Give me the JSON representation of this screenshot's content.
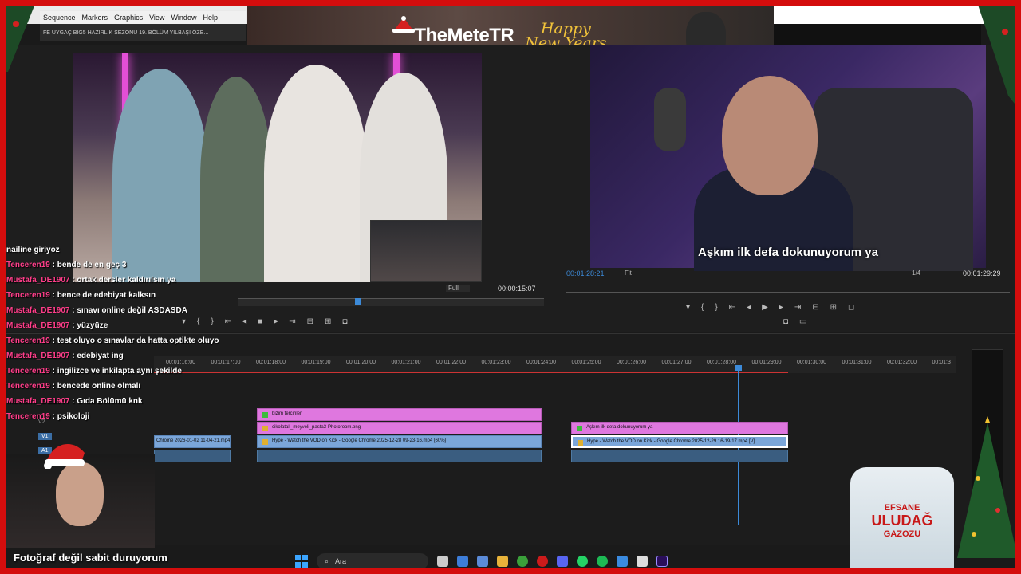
{
  "premiere_menu": [
    "Sequence",
    "Markers",
    "Graphics",
    "View",
    "Window",
    "Help"
  ],
  "browser_tab_text": "FE UYGAÇ BIG5 HAZIRLIK SEZONU 19. BÖLÜM YILBAŞI ÖZE...",
  "overlay": {
    "brand": "TheMeteTR",
    "greeting_line1": "Happy",
    "greeting_line2": "New Years",
    "webcam_caption": "Fotoğraf değil sabit duruyorum"
  },
  "source_monitor": {
    "fit": "Full",
    "timecode": "00:00:15:07"
  },
  "program_monitor": {
    "subtitle": "Aşkım ilk defa dokunuyorum ya",
    "timecode": "00:01:28:21",
    "fit": "Fit",
    "resolution": "1/4",
    "end_timecode": "00:01:29:29"
  },
  "timeline": {
    "ruler": [
      "00:01:16:00",
      "00:01:17:00",
      "00:01:18:00",
      "00:01:19:00",
      "00:01:20:00",
      "00:01:21:00",
      "00:01:22:00",
      "00:01:23:00",
      "00:01:24:00",
      "00:01:25:00",
      "00:01:26:00",
      "00:01:27:00",
      "00:01:28:00",
      "00:01:29:00",
      "00:01:30:00",
      "00:01:31:00",
      "00:01:32:00",
      "00:01:3"
    ],
    "track_labels": [
      "V2",
      "V1",
      "A1"
    ],
    "clips": {
      "v3_a": "bizim tercihler",
      "v2_a": "cikolatali_meyveli_pasta3-Photoroom.png",
      "v1_left": "Chrome 2026-01-02 11-04-21.mp4",
      "v1_a": "Hype - Watch the VOD on Kick - Google Chrome 2025-12-28 09-23-16.mp4 [60%]",
      "v2_b": "Aşkım ilk defa dokunuyorum ya",
      "v1_b": "Hype - Watch the VOD on Kick - Google Chrome 2025-12-29 16-19-17.mp4 [V]"
    }
  },
  "chat": {
    "top_fragment": "nailine giriyoz",
    "messages": [
      {
        "user": "Tenceren19",
        "text": " : bende de en geç 3"
      },
      {
        "user": "Mustafa_DE1907",
        "text": " : ortak dersler kaldırılsın ya"
      },
      {
        "user": "Tenceren19",
        "text": " : bence de edebiyat kalksın"
      },
      {
        "user": "Mustafa_DE1907",
        "text": " : sınavı online değil ASDASDA"
      },
      {
        "user": "Mustafa_DE1907",
        "text": " : yüzyüze"
      },
      {
        "user": "Tenceren19",
        "text": " : test oluyo o sınavlar da hatta optikte oluyo"
      },
      {
        "user": "Mustafa_DE1907",
        "text": " : edebiyat ing"
      },
      {
        "user": "Tenceren19",
        "text": " : ingilizce ve inkilapta aynı şekilde"
      },
      {
        "user": "Tenceren19",
        "text": " : bencede online olmalı"
      },
      {
        "user": "Mustafa_DE1907",
        "text": " : Gıda Bölümü knk"
      },
      {
        "user": "Tenceren19",
        "text": " : psikoloji"
      }
    ]
  },
  "taskbar": {
    "search_label": "Ara"
  },
  "product": {
    "line1": "EFSANE",
    "line2": "ULUDAĞ",
    "line3": "GAZOZU"
  },
  "colors": {
    "frame": "#d40d0d",
    "playhead": "#3c8ad8",
    "clip_pink": "#df77df",
    "clip_blue": "#7ba6d9",
    "chat_user": "#ff3e8a"
  }
}
